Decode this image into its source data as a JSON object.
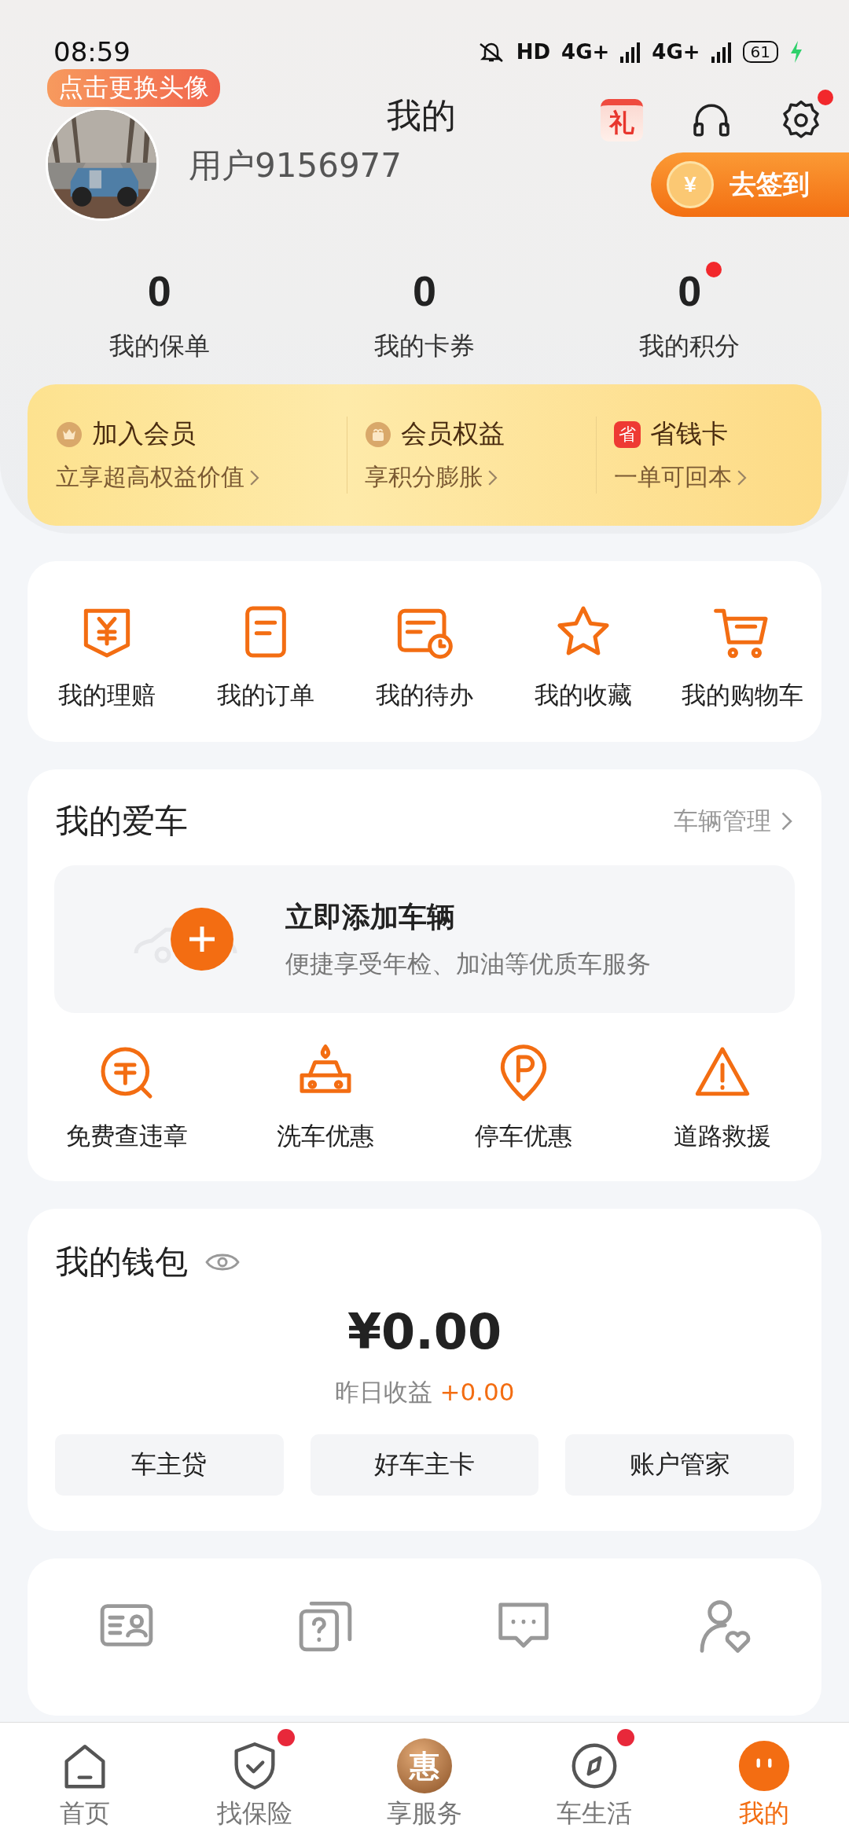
{
  "status_bar": {
    "time": "08:59",
    "network": [
      "HD",
      "4G+",
      "4G+"
    ],
    "battery": "61"
  },
  "header": {
    "avatar_tip": "点击更换头像",
    "title": "我的",
    "username": "用户9156977",
    "gift_text": "礼",
    "settings_badge": true,
    "checkin": {
      "coin": "¥",
      "label": "去签到"
    }
  },
  "stats": [
    {
      "value": "0",
      "label": "我的保单",
      "badge": false
    },
    {
      "value": "0",
      "label": "我的卡券",
      "badge": false
    },
    {
      "value": "0",
      "label": "我的积分",
      "badge": true
    }
  ],
  "membership": [
    {
      "kind": "crown",
      "title": "加入会员",
      "subtitle": "立享超高权益价值"
    },
    {
      "kind": "gift",
      "title": "会员权益",
      "subtitle": "享积分膨胀"
    },
    {
      "kind": "char",
      "icon_text": "省",
      "title": "省钱卡",
      "subtitle": "一单可回本"
    }
  ],
  "shortcuts": [
    {
      "kind": "yen",
      "label": "我的理赔"
    },
    {
      "kind": "doc",
      "label": "我的订单"
    },
    {
      "kind": "calendar",
      "label": "我的待办"
    },
    {
      "kind": "star",
      "label": "我的收藏"
    },
    {
      "kind": "cart",
      "label": "我的购物车"
    }
  ],
  "car": {
    "title": "我的爱车",
    "link": "车辆管理",
    "add_title": "立即添加车辆",
    "add_subtitle": "便捷享受年检、加油等优质车服务",
    "services": [
      {
        "kind": "ticket",
        "label": "免费查违章"
      },
      {
        "kind": "wash",
        "label": "洗车优惠"
      },
      {
        "kind": "parking",
        "label": "停车优惠"
      },
      {
        "kind": "warning",
        "label": "道路救援"
      }
    ]
  },
  "wallet": {
    "title": "我的钱包",
    "amount": "¥0.00",
    "yesterday_label": "昨日收益",
    "yesterday_value": "+0.00",
    "buttons": [
      "车主贷",
      "好车主卡",
      "账户管家"
    ]
  },
  "tools": [
    {
      "kind": "idcard"
    },
    {
      "kind": "question"
    },
    {
      "kind": "chat"
    },
    {
      "kind": "person"
    }
  ],
  "nav": [
    {
      "kind": "home",
      "label": "首页",
      "selected": false,
      "badge": false
    },
    {
      "kind": "shield",
      "label": "找保险",
      "selected": false,
      "badge": true
    },
    {
      "kind": "char",
      "icon_text": "惠",
      "label": "享服务",
      "selected": false,
      "badge": false
    },
    {
      "kind": "compass",
      "label": "车生活",
      "selected": false,
      "badge": true
    },
    {
      "kind": "face",
      "label": "我的",
      "selected": true,
      "badge": false
    }
  ]
}
